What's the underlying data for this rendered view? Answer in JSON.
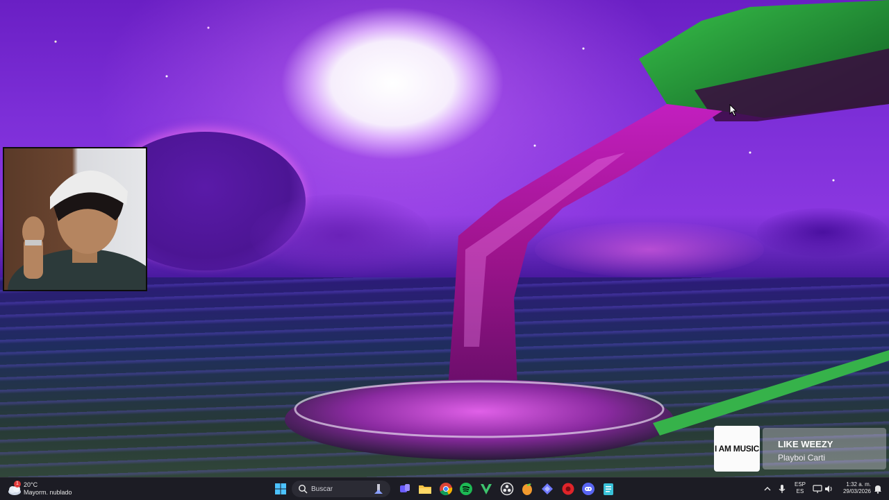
{
  "taskbar": {
    "weather": {
      "temperature": "20°C",
      "condition": "Mayorm. nublado",
      "badge": "1",
      "icon": "cloud-icon"
    },
    "search": {
      "label": "Buscar",
      "icon": "search-icon"
    },
    "apps": [
      {
        "name": "start-button",
        "icon": "windows-logo-icon"
      },
      {
        "name": "task-view-button",
        "icon": "task-view-icon"
      },
      {
        "name": "file-explorer",
        "icon": "folder-icon"
      },
      {
        "name": "chrome",
        "icon": "chrome-icon"
      },
      {
        "name": "spotify",
        "icon": "spotify-icon"
      },
      {
        "name": "vegas",
        "icon": "v-logo-icon"
      },
      {
        "name": "obs",
        "icon": "obs-icon"
      },
      {
        "name": "fl-studio",
        "icon": "fruit-icon"
      },
      {
        "name": "app-diamond",
        "icon": "diamond-icon"
      },
      {
        "name": "record-app",
        "icon": "record-icon"
      },
      {
        "name": "discord-app",
        "icon": "gamepad-icon"
      },
      {
        "name": "notes-app",
        "icon": "notepad-icon"
      }
    ],
    "tray": {
      "language_top": "ESP",
      "language_bottom": "ES",
      "time": "1:32 a. m.",
      "date": "29/03/2026"
    }
  },
  "media_card": {
    "thumbnail_text": "I AM MUSIC",
    "title": "LIKE WEEZY",
    "artist": "Playboi Carti"
  },
  "colors": {
    "taskbar_bg": "#1c1c24",
    "accent_purple": "#8a37e0",
    "spotify_green": "#1db954"
  }
}
